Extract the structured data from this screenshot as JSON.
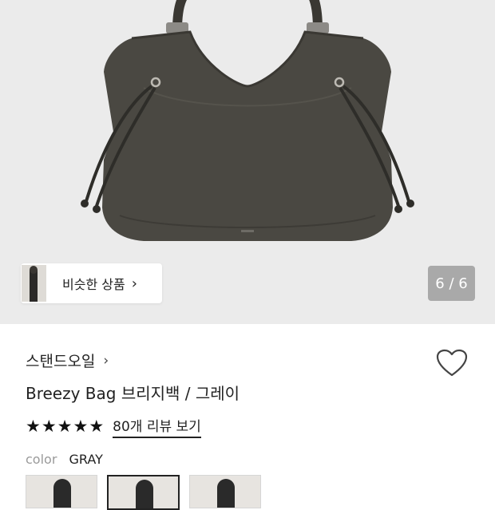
{
  "gallery": {
    "similar_label": "비슷한 상품",
    "similar_chevron": "›",
    "counter": "6 / 6"
  },
  "product": {
    "brand": "스탠드오일",
    "brand_chevron": "›",
    "title": "Breezy Bag 브리지백 / 그레이",
    "rating_stars": 5,
    "reviews_link": "80개 리뷰 보기",
    "color_label": "color",
    "color_value": "GRAY",
    "swatch_count": 3,
    "selected_swatch": 2
  },
  "icons": [
    "heart-icon",
    "star-icon",
    "chevron-right-icon"
  ]
}
